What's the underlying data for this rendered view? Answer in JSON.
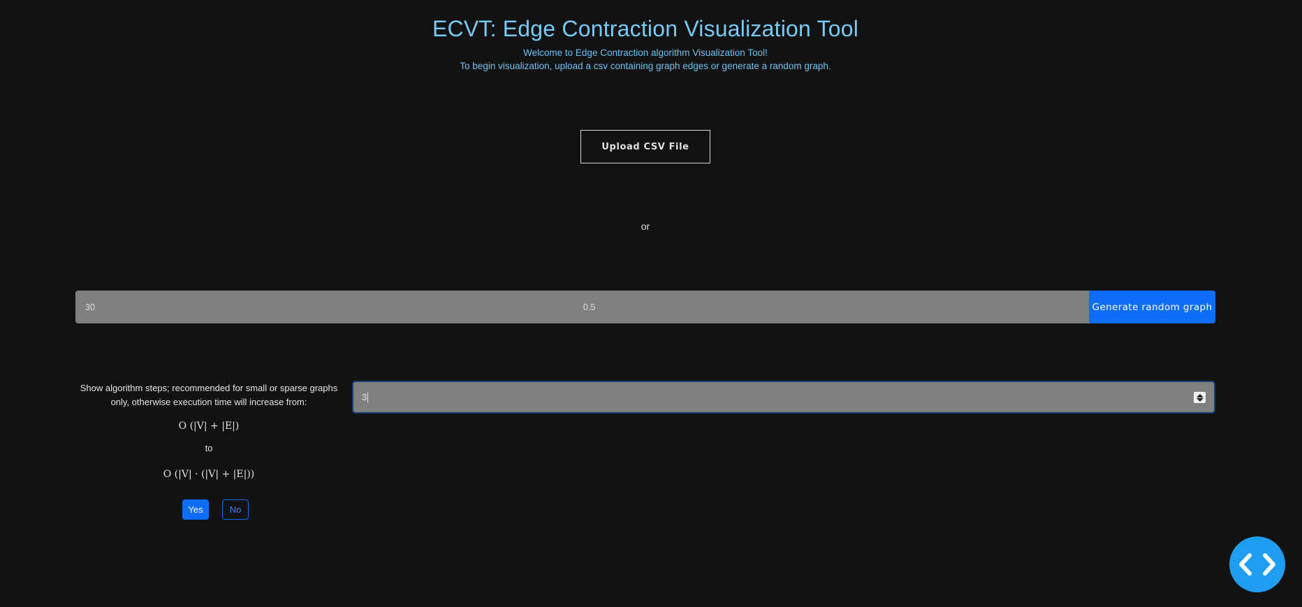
{
  "header": {
    "title": "ECVT: Edge Contraction Visualization Tool",
    "subtitle_line1": "Welcome to Edge Contraction algorithm Visualization Tool!",
    "subtitle_line2": "To begin visualization, upload a csv containing graph edges or generate a random graph."
  },
  "upload": {
    "button_label": "Upload CSV File"
  },
  "separator_text": "or",
  "generator": {
    "vertices_value": "30",
    "probability_value": "0.5",
    "button_label": "Generate random graph"
  },
  "steps": {
    "description": "Show algorithm steps; recommended for small or sparse graphs only, otherwise execution time will increase from:",
    "complexity_from": "O (|V| + |E|)",
    "to_text": "to",
    "complexity_to": "O (|V| · (|V| + |E|))",
    "yes_label": "Yes",
    "no_label": "No",
    "input_value": "3"
  },
  "fab": {
    "icon": "code-icon"
  },
  "colors": {
    "background": "#121212",
    "title": "#78caf6",
    "primary": "#0d6efd",
    "input_bg": "#808080",
    "fab": "#1f9df3"
  }
}
